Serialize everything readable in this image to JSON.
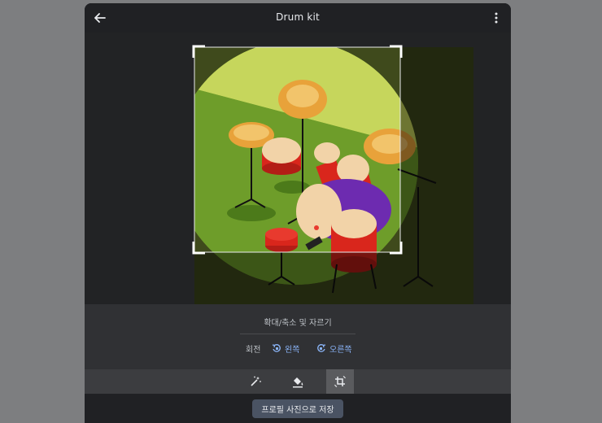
{
  "header": {
    "title": "Drum kit",
    "back_icon": "arrow-back-icon",
    "more_icon": "more-vert-icon"
  },
  "editor": {
    "zoom_crop_label": "확대/축소 및 자르기",
    "rotate_label": "회전",
    "rotate_left_label": "왼쪽",
    "rotate_right_label": "오른쪽"
  },
  "toolbar": {
    "tools": [
      {
        "name": "effects",
        "icon": "magic-wand-icon",
        "selected": false
      },
      {
        "name": "fill",
        "icon": "paint-bucket-icon",
        "selected": false
      },
      {
        "name": "crop-rotate",
        "icon": "crop-rotate-icon",
        "selected": true
      }
    ]
  },
  "footer": {
    "save_label": "프로필 사진으로 저장"
  },
  "colors": {
    "accent": "#8ab4f8",
    "dialog_bg": "#202124",
    "panel_bg": "#303134",
    "button_bg": "#4a5363"
  }
}
